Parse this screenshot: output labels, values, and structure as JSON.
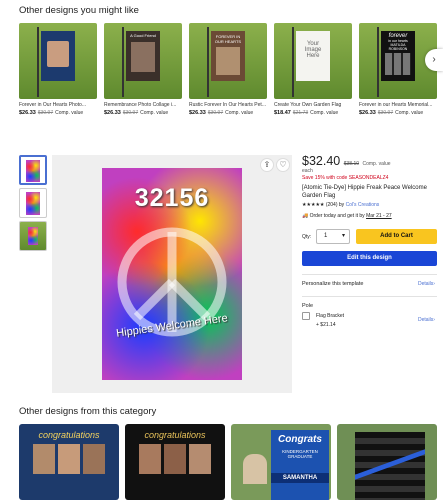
{
  "top_section": {
    "title": "Other designs you might like",
    "items": [
      {
        "title": "Forever in Our Hearts Photo...",
        "price": "$26.33",
        "original": "$30.97",
        "comp": "Comp. value"
      },
      {
        "title": "Remembrance Photo Collage i...",
        "price": "$26.33",
        "original": "$30.97",
        "comp": "Comp. value"
      },
      {
        "title": "Rustic Forever In Our Hearts Pet...",
        "price": "$26.33",
        "original": "$30.97",
        "comp": "Comp. value"
      },
      {
        "title": "Create Your Own Garden Flag",
        "price": "$18.47",
        "original": "$21.73",
        "comp": "Comp. value"
      },
      {
        "title": "Forever in our Hearts Memorial...",
        "price": "$26.33",
        "original": "$30.97",
        "comp": "Comp. value"
      }
    ],
    "flag_texts": {
      "flag2": "A Good Friend",
      "flag3": "FOREVER IN OUR HEARTS",
      "flag4": "Your Image Here",
      "flag5_line1": "forever",
      "flag5_line2": "in our hearts",
      "flag5_line3": "MATILDA ROBINSON"
    },
    "next_icon": "chevron-right-icon"
  },
  "product": {
    "image_number": "32156",
    "image_text": "Hippies Welcome Here",
    "price": "$32.40",
    "original_price": "$38.10",
    "comp_value": "Comp. value",
    "per": "each",
    "sale": "Save 15% with code SEASONDEALZ4",
    "title": "[Atomic Tie-Dye] Hippie Freak Peace Welcome Garden Flag",
    "stars": "★★★★★",
    "reviews": "(204)",
    "by": "by",
    "seller": "Col's Creations",
    "delivery_prefix": "Order today and get it by",
    "delivery_date": "Mar 21 - 27",
    "qty_label": "Qty:",
    "qty_value": "1",
    "add_to_cart": "Add to Cart",
    "edit_design": "Edit this design",
    "personalize": "Personalize this template",
    "details1": "Details",
    "pole_heading": "Pole",
    "pole_option": "Flag Bracket",
    "pole_price": "+ $21.14",
    "details2": "Details"
  },
  "bottom_section": {
    "title": "Other designs from this category",
    "card1_text": "congratulations",
    "card2_text": "congratulations",
    "card3_line1": "Congrats",
    "card3_line2": "KINDERGARTEN GRADUATE",
    "card3_line3": "SAMANTHA"
  },
  "colors": {
    "accent": "#4a6fd1",
    "cart": "#f9c51f",
    "edit": "#1a46d6",
    "sale": "#d0021b"
  }
}
